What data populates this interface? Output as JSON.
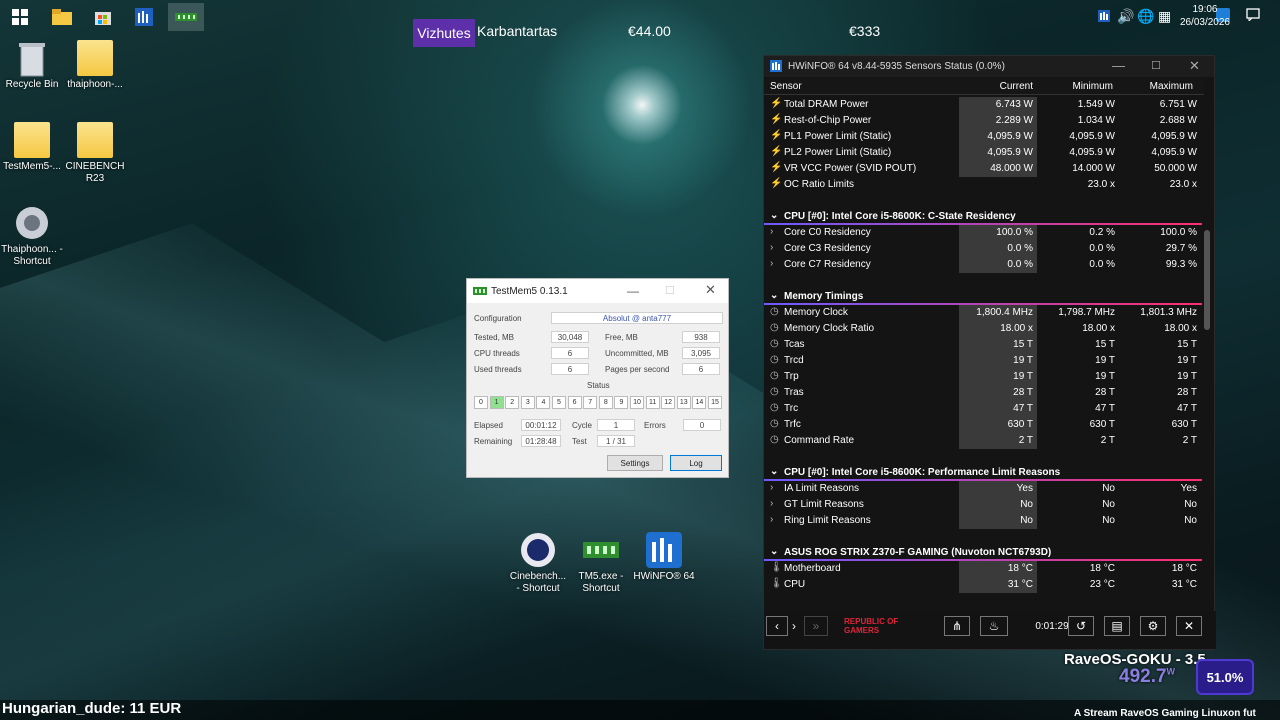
{
  "taskbar": {
    "ticker": {
      "vizhutes": "Vizhutes",
      "karbantartas": "Karbantartas",
      "price1": "€44.00",
      "price2": "€333"
    },
    "time": "19:06",
    "date": "26/03/2026"
  },
  "desktop": [
    {
      "label": "Recycle Bin"
    },
    {
      "label": "thaiphoon-..."
    },
    {
      "label": "TestMem5-..."
    },
    {
      "label": "CINEBENCH R23"
    },
    {
      "label": "Thaiphoon... - Shortcut"
    },
    {
      "label": "Cinebench... - Shortcut"
    },
    {
      "label": "TM5.exe - Shortcut"
    },
    {
      "label": "HWiNFO® 64"
    }
  ],
  "testmem": {
    "title": "TestMem5  0.13.1",
    "config_label": "Configuration",
    "config_value": "Absolut @ anta777",
    "tested_label": "Tested, MB",
    "tested": "30,048",
    "free_label": "Free, MB",
    "free": "938",
    "cpu_label": "CPU threads",
    "cpu": "6",
    "uncommitted_label": "Uncommitted, MB",
    "uncommitted": "3,095",
    "used_label": "Used threads",
    "used": "6",
    "pps_label": "Pages per second",
    "pps": "6",
    "status_label": "Status",
    "cells": [
      "0",
      "1",
      "2",
      "3",
      "4",
      "5",
      "6",
      "7",
      "8",
      "9",
      "10",
      "11",
      "12",
      "13",
      "14",
      "15"
    ],
    "elapsed_label": "Elapsed",
    "elapsed": "00:01:12",
    "cycle_label": "Cycle",
    "cycle": "1",
    "errors_label": "Errors",
    "errors": "0",
    "remaining_label": "Remaining",
    "remaining": "01:28:48",
    "test_label": "Test",
    "test": "1 / 31",
    "settings": "Settings",
    "log": "Log"
  },
  "hwinfo": {
    "title": "HWiNFO® 64 v8.44-5935 Sensors Status (0.0%)",
    "headers": {
      "sensor": "Sensor",
      "current": "Current",
      "minimum": "Minimum",
      "maximum": "Maximum"
    },
    "rows1": [
      {
        "n": "Total DRAM Power",
        "c": "6.743 W",
        "m": "1.549 W",
        "x": "6.751 W"
      },
      {
        "n": "Rest-of-Chip Power",
        "c": "2.289 W",
        "m": "1.034 W",
        "x": "2.688 W"
      },
      {
        "n": "PL1 Power Limit (Static)",
        "c": "4,095.9 W",
        "m": "4,095.9 W",
        "x": "4,095.9 W"
      },
      {
        "n": "PL2 Power Limit (Static)",
        "c": "4,095.9 W",
        "m": "4,095.9 W",
        "x": "4,095.9 W"
      },
      {
        "n": "VR VCC Power (SVID POUT)",
        "c": "48.000 W",
        "m": "14.000 W",
        "x": "50.000 W"
      },
      {
        "n": "OC Ratio Limits",
        "c": "",
        "m": "23.0 x",
        "x": "23.0 x"
      }
    ],
    "group2": "CPU [#0]: Intel Core i5-8600K: C-State Residency",
    "rows2": [
      {
        "n": "Core C0 Residency",
        "c": "100.0 %",
        "m": "0.2 %",
        "x": "100.0 %"
      },
      {
        "n": "Core C3 Residency",
        "c": "0.0 %",
        "m": "0.0 %",
        "x": "29.7 %"
      },
      {
        "n": "Core C7 Residency",
        "c": "0.0 %",
        "m": "0.0 %",
        "x": "99.3 %"
      }
    ],
    "group3": "Memory Timings",
    "rows3": [
      {
        "n": "Memory Clock",
        "c": "1,800.4 MHz",
        "m": "1,798.7 MHz",
        "x": "1,801.3 MHz"
      },
      {
        "n": "Memory Clock Ratio",
        "c": "18.00 x",
        "m": "18.00 x",
        "x": "18.00 x"
      },
      {
        "n": "Tcas",
        "c": "15 T",
        "m": "15 T",
        "x": "15 T"
      },
      {
        "n": "Trcd",
        "c": "19 T",
        "m": "19 T",
        "x": "19 T"
      },
      {
        "n": "Trp",
        "c": "19 T",
        "m": "19 T",
        "x": "19 T"
      },
      {
        "n": "Tras",
        "c": "28 T",
        "m": "28 T",
        "x": "28 T"
      },
      {
        "n": "Trc",
        "c": "47 T",
        "m": "47 T",
        "x": "47 T"
      },
      {
        "n": "Trfc",
        "c": "630 T",
        "m": "630 T",
        "x": "630 T"
      },
      {
        "n": "Command Rate",
        "c": "2 T",
        "m": "2 T",
        "x": "2 T"
      }
    ],
    "group4": "CPU [#0]: Intel Core i5-8600K: Performance Limit Reasons",
    "rows4": [
      {
        "n": "IA Limit Reasons",
        "c": "Yes",
        "m": "No",
        "x": "Yes"
      },
      {
        "n": "GT Limit Reasons",
        "c": "No",
        "m": "No",
        "x": "No"
      },
      {
        "n": "Ring Limit Reasons",
        "c": "No",
        "m": "No",
        "x": "No"
      }
    ],
    "group5": "ASUS ROG STRIX Z370-F GAMING (Nuvoton NCT6793D)",
    "rows5": [
      {
        "n": "Motherboard",
        "c": "18 °C",
        "m": "18 °C",
        "x": "18 °C"
      },
      {
        "n": "CPU",
        "c": "31 °C",
        "m": "23 °C",
        "x": "31 °C"
      }
    ],
    "timer": "0:01:29",
    "rog_text": "REPUBLIC OF GAMERS"
  },
  "overlay": {
    "rave": "RaveOS-GOKU - 3.5",
    "watts": "492.7",
    "watts_unit": "W",
    "percent": "51.0%",
    "donation": "Hungarian_dude: 11 EUR",
    "stream": "A Stream RaveOS Gaming Linuxon fut"
  }
}
